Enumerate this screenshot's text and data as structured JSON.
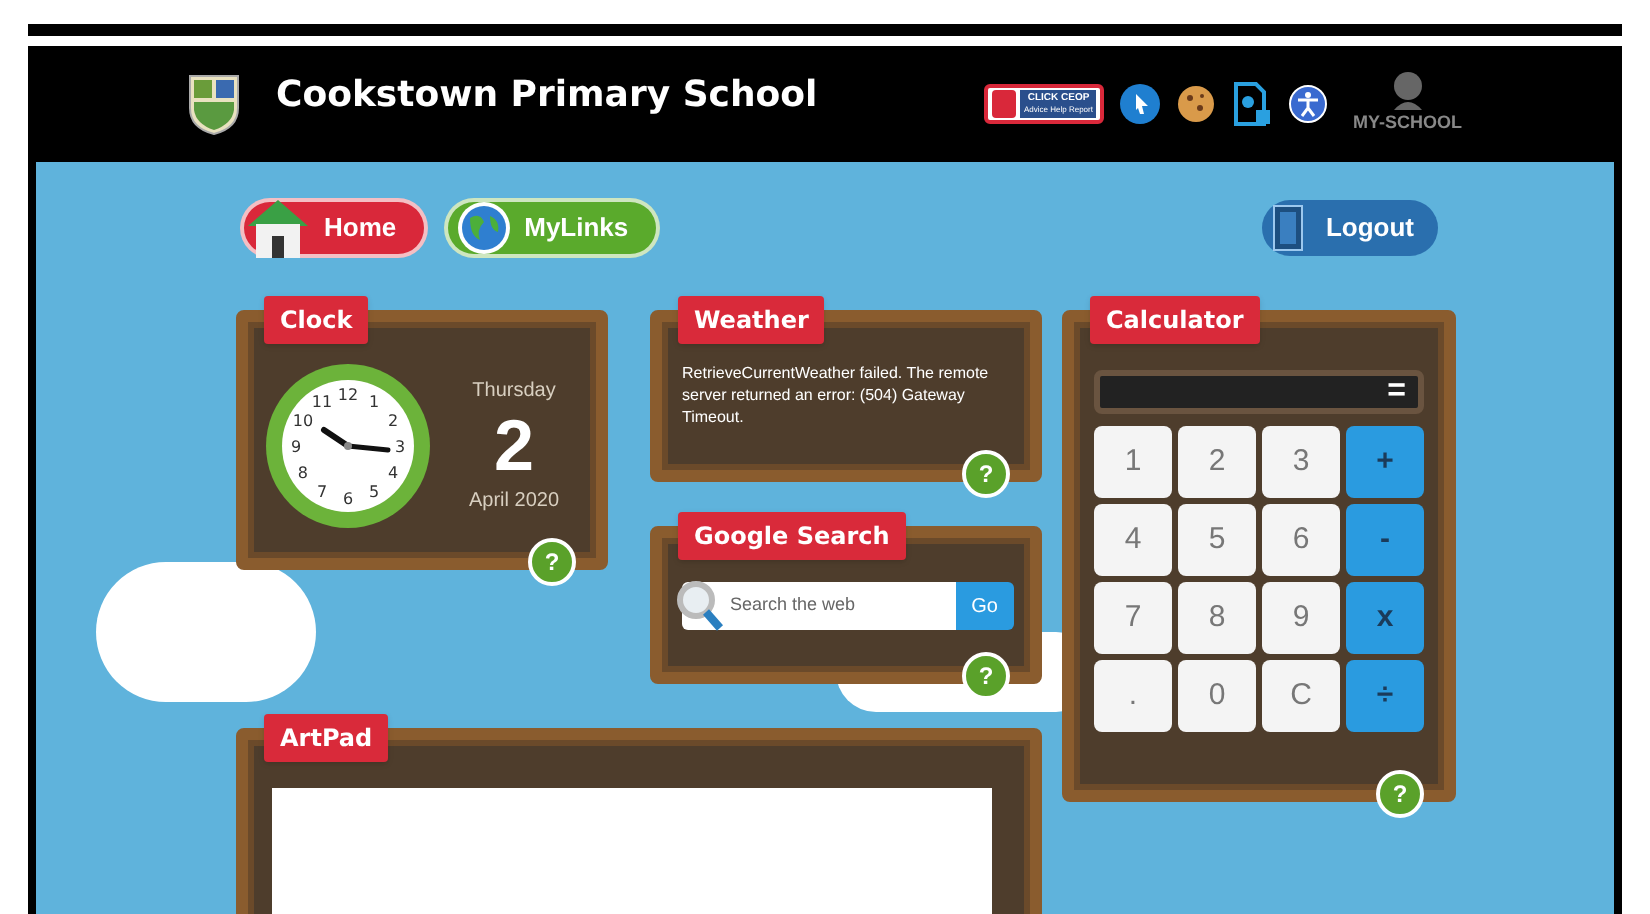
{
  "header": {
    "school_name": "Cookstown Primary School",
    "ceop": {
      "title": "CLICK CEOP",
      "subtitle": "Advice Help Report"
    },
    "brand": "MY-SCHOOL"
  },
  "nav": [
    {
      "label": "Home",
      "kind": "home"
    },
    {
      "label": "MyLinks",
      "kind": "links"
    }
  ],
  "logout": {
    "label": "Logout"
  },
  "clock": {
    "title": "Clock",
    "dial_numbers": [
      "12",
      "11",
      "1",
      "10",
      "2",
      "9",
      "3",
      "8",
      "4",
      "7",
      "5",
      "6"
    ],
    "weekday": "Thursday",
    "day": "2",
    "month_year": "April 2020",
    "help": "?"
  },
  "weather": {
    "title": "Weather",
    "message": "RetrieveCurrentWeather failed. The remote server returned an error: (504) Gateway Timeout.",
    "help": "?"
  },
  "search": {
    "title": "Google Search",
    "placeholder": "Search the web",
    "button": "Go",
    "help": "?"
  },
  "calculator": {
    "title": "Calculator",
    "equals": "=",
    "keys": [
      {
        "label": "1",
        "kind": "digit"
      },
      {
        "label": "2",
        "kind": "digit"
      },
      {
        "label": "3",
        "kind": "digit"
      },
      {
        "label": "+",
        "kind": "op"
      },
      {
        "label": "4",
        "kind": "digit"
      },
      {
        "label": "5",
        "kind": "digit"
      },
      {
        "label": "6",
        "kind": "digit"
      },
      {
        "label": "-",
        "kind": "op"
      },
      {
        "label": "7",
        "kind": "digit"
      },
      {
        "label": "8",
        "kind": "digit"
      },
      {
        "label": "9",
        "kind": "digit"
      },
      {
        "label": "x",
        "kind": "op"
      },
      {
        "label": ".",
        "kind": "digit"
      },
      {
        "label": "0",
        "kind": "digit"
      },
      {
        "label": "C",
        "kind": "digit"
      },
      {
        "label": "÷",
        "kind": "op"
      }
    ],
    "help": "?"
  },
  "artpad": {
    "title": "ArtPad"
  }
}
